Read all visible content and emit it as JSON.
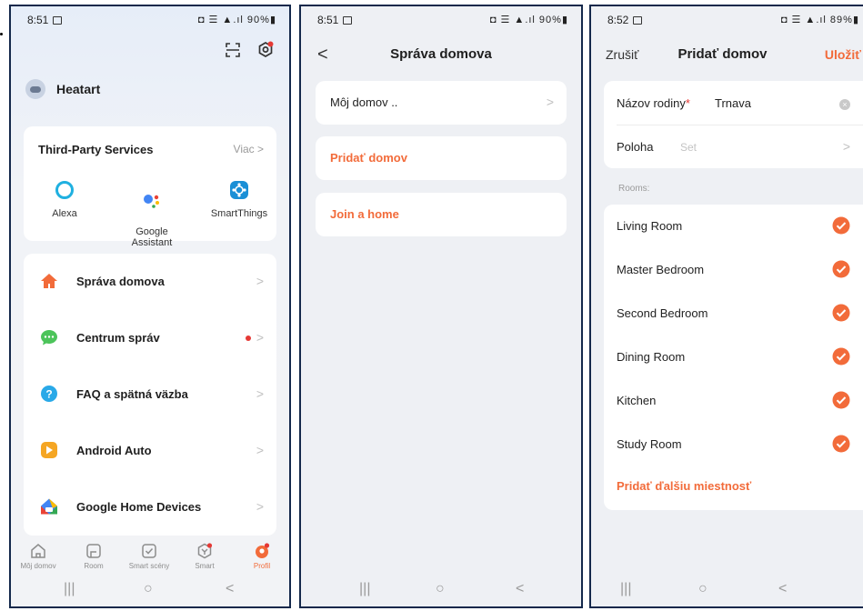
{
  "screen1": {
    "status": {
      "time": "8:51",
      "right": "◘ ☰ ▲.ıl 90%▮"
    },
    "user_name": "Heatart",
    "third_party": {
      "title": "Third-Party Services",
      "more": "Viac >",
      "services": [
        {
          "label": "Alexa",
          "icon": "alexa-icon"
        },
        {
          "label": "Google\nAssistant",
          "icon": "google-assistant-icon"
        },
        {
          "label": "SmartThings",
          "icon": "smartthings-icon"
        }
      ]
    },
    "menu": [
      {
        "label": "Správa domova",
        "icon": "house-icon",
        "color": "#f26b3a"
      },
      {
        "label": "Centrum správ",
        "icon": "chat-bubble-icon",
        "color": "#4cc45a",
        "badge": true
      },
      {
        "label": "FAQ a spätná väzba",
        "icon": "question-icon",
        "color": "#29a9e8"
      },
      {
        "label": "Android Auto",
        "icon": "android-auto-icon",
        "color": "#f5a623"
      },
      {
        "label": "Google Home Devices",
        "icon": "google-home-icon",
        "color": "#4285f4"
      }
    ],
    "tabs": [
      {
        "label": "Môj domov",
        "icon": "home-tab-icon"
      },
      {
        "label": "Room",
        "icon": "room-tab-icon"
      },
      {
        "label": "Smart scény",
        "icon": "scene-tab-icon"
      },
      {
        "label": "Smart",
        "icon": "smart-tab-icon"
      },
      {
        "label": "Profil",
        "icon": "profile-tab-icon",
        "active": true
      }
    ]
  },
  "screen2": {
    "status": {
      "time": "8:51",
      "right": "◘ ☰ ▲.ıl 90%▮"
    },
    "title": "Správa domova",
    "rows": [
      {
        "label": "Môj domov ..",
        "accent": false
      },
      {
        "label": "Pridať domov",
        "accent": true
      },
      {
        "label": "Join a home",
        "accent": true
      }
    ]
  },
  "screen3": {
    "status": {
      "time": "8:52",
      "right": "◘ ☰ ▲.ıl 89%▮"
    },
    "cancel": "Zrušiť",
    "title": "Pridať domov",
    "save": "Uložiť",
    "family_label": "Názov rodiny",
    "family_required": "*",
    "family_value": "Trnava",
    "location_label": "Poloha",
    "location_placeholder": "Set",
    "rooms_label": "Rooms:",
    "rooms": [
      "Living Room",
      "Master Bedroom",
      "Second Bedroom",
      "Dining Room",
      "Kitchen",
      "Study Room"
    ],
    "add_room": "Pridať ďalšiu miestnosť"
  },
  "colors": {
    "accent": "#f26b3a",
    "frame": "#14284b"
  }
}
